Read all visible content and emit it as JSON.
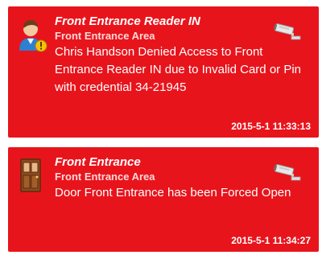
{
  "alarms": [
    {
      "icon": "person-warning-icon",
      "title": "Front Entrance Reader IN",
      "area": "Front Entrance Area",
      "message": "Chris Handson Denied Access to Front Entrance Reader IN due to Invalid Card or Pin with credential 34-21945",
      "timestamp": "2015-5-1 11:33:13"
    },
    {
      "icon": "door-icon",
      "title": "Front Entrance",
      "area": "Front Entrance Area",
      "message": "Door Front Entrance has been Forced Open",
      "timestamp": "2015-5-1 11:34:27"
    }
  ],
  "colors": {
    "card_background": "#e8141c",
    "text": "#ffffff"
  },
  "camera_icon": "security-camera-icon"
}
